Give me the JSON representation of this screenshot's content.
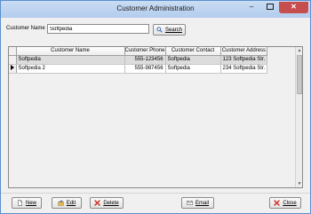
{
  "window": {
    "title": "Customer Administration",
    "minimize_glyph": "–",
    "close_glyph": "✕"
  },
  "search": {
    "label": "Customer Name",
    "value": "Softpedia",
    "button_label": "Search",
    "button_icon": "search-icon"
  },
  "table": {
    "columns": [
      "Customer Name",
      "Customer Phone",
      "Customer Contact",
      "Customer Address"
    ],
    "rows": [
      [
        "Softpedia",
        "555-123456",
        "Softpedia",
        "123 Softpedia Str."
      ],
      [
        "Softpedia 2",
        "555-987456",
        "Softpedia",
        "234 Softpedia Str."
      ]
    ],
    "current_row_index": 1
  },
  "buttons": {
    "new": {
      "label": "New",
      "icon": "new-document-icon",
      "color": "#ffffff"
    },
    "edit": {
      "label": "Edit",
      "icon": "edit-icon",
      "color": "#e8b84a"
    },
    "delete": {
      "label": "Delete",
      "icon": "delete-icon",
      "color": "#d13a2f"
    },
    "email": {
      "label": "Email",
      "icon": "email-icon",
      "color": "#5c5c5c"
    },
    "close": {
      "label": "Close",
      "icon": "close-icon",
      "color": "#d13a2f"
    }
  },
  "colors": {
    "title_bar": "#b3cdee",
    "close_button": "#c74e4e",
    "selected_row": "#dcdcdc"
  }
}
